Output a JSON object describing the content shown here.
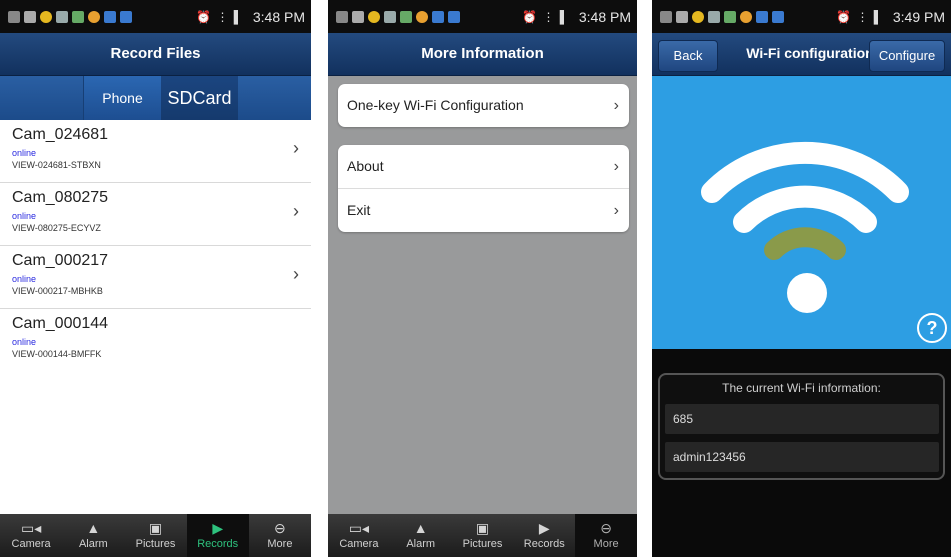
{
  "status_bar": {
    "time_1": "3:48 PM",
    "time_2": "3:48 PM",
    "time_3": "3:49 PM"
  },
  "screen1": {
    "title": "Record Files",
    "segments": {
      "phone": "Phone",
      "sdcard": "SDCard"
    },
    "records": [
      {
        "name": "Cam_024681",
        "status": "online",
        "uid": "VIEW-024681-STBXN",
        "chevron": "›"
      },
      {
        "name": "Cam_080275",
        "status": "online",
        "uid": "VIEW-080275-ECYVZ",
        "chevron": "›"
      },
      {
        "name": "Cam_000217",
        "status": "online",
        "uid": "VIEW-000217-MBHKB",
        "chevron": "›"
      },
      {
        "name": "Cam_000144",
        "status": "online",
        "uid": "VIEW-000144-BMFFK",
        "chevron": ""
      }
    ]
  },
  "tabs": [
    {
      "label": "Camera",
      "icon": "camera-icon"
    },
    {
      "label": "Alarm",
      "icon": "bell-icon"
    },
    {
      "label": "Pictures",
      "icon": "picture-icon"
    },
    {
      "label": "Records",
      "icon": "record-icon"
    },
    {
      "label": "More",
      "icon": "more-icon"
    }
  ],
  "screen2": {
    "title": "More Information",
    "items": {
      "wifi_config": "One-key Wi-Fi Configuration",
      "about": "About",
      "exit": "Exit"
    }
  },
  "screen3": {
    "back": "Back",
    "title": "Wi-Fi configuration",
    "configure": "Configure",
    "help": "?",
    "info_heading": "The current Wi-Fi information:",
    "ssid_value": "685",
    "password_value": "admin123456"
  },
  "colors": {
    "title_bar": "#1a3c6e",
    "active_tab": "#2ec27e",
    "wifi_panel": "#2d9ee3",
    "wifi_arc_dim": "#8a9a4a",
    "online_text": "#2a2ae0"
  }
}
